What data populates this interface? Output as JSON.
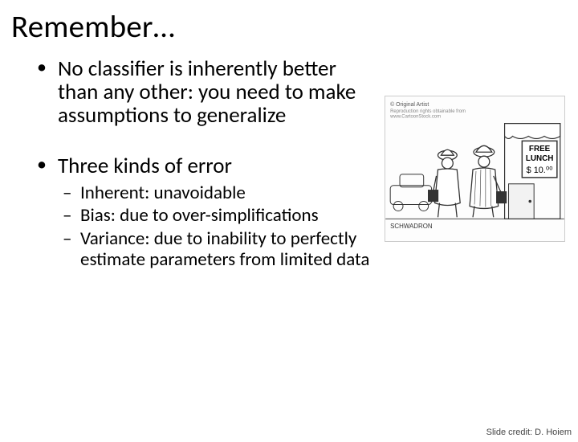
{
  "title": "Remember…",
  "bullets": [
    {
      "text": "No classifier is inherently better than any other: you need to make assumptions to generalize"
    },
    {
      "text": "Three kinds of error",
      "sub": [
        "Inherent: unavoidable",
        "Bias: due to over-simplifications",
        "Variance: due to inability to perfectly estimate parameters from limited data"
      ]
    }
  ],
  "cartoon": {
    "caption_top": "© Original Artist",
    "sign_line1": "FREE",
    "sign_line2": "LUNCH",
    "sign_line3": "$ 10.⁰⁰",
    "signature": "SCHWADRON"
  },
  "credit": "Slide credit: D. Hoiem"
}
